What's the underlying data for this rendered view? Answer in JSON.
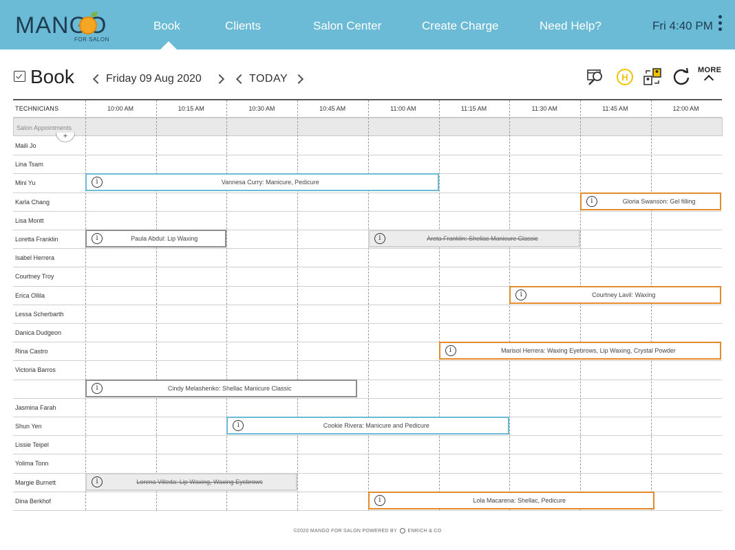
{
  "header": {
    "logo": {
      "word": "MANGO",
      "sub": "FOR SALON"
    },
    "nav": [
      "Book",
      "Clients",
      "Salon Center",
      "Create Charge",
      "Need Help?"
    ],
    "clock": "Fri 4:40 PM"
  },
  "toolbar": {
    "title": "Book",
    "date": "Friday 09 Aug 2020",
    "today": "TODAY",
    "more": "MORE",
    "icons": [
      "search-calendar-icon",
      "h-badge-icon",
      "swap-users-icon",
      "refresh-icon"
    ]
  },
  "grid": {
    "tech_header": "TECHNICIANS",
    "times": [
      "10:00 AM",
      "10:15 AM",
      "10:30 AM",
      "10:45 AM",
      "11:00 AM",
      "11:15 AM",
      "11:30 AM",
      "11:45 AM",
      "12:00 AM"
    ],
    "salon_row": "Salon Appointments",
    "salon_add": "+",
    "technicians": [
      "Maili Jo",
      "Lina Tsam",
      "Mini Yu",
      "Karla Chang",
      "Lisa Montt",
      "Loretta Franklin",
      "Isabel Herrera",
      "Courtney Troy",
      "Erica Ollila",
      "Lessa Scherbarth",
      "Danica Dudgeon",
      "Rina Castro",
      "Victoria Barros",
      "",
      "Jasmina Farah",
      "Shun Yen",
      "Lissie Teipel",
      "Yolima Tonn",
      "Margie Burnett",
      "Dina Berkhof"
    ]
  },
  "appointments": [
    {
      "row": 2,
      "start": "10:00 AM",
      "slots": 5,
      "status": "blue",
      "text": "Vannesa Curry: Manicure, Pedicure"
    },
    {
      "row": 3,
      "start": "11:45 AM",
      "slots": 2,
      "status": "orange",
      "text": "Gloria Swanson: Gel filling"
    },
    {
      "row": 5,
      "start": "10:00 AM",
      "slots": 2,
      "status": "gray",
      "text": "Paula Abdul: Lip Waxing"
    },
    {
      "row": 5,
      "start": "11:00 AM",
      "slots": 3,
      "status": "cancel",
      "text": "Areta Franklin: Shellac Manicure Classic"
    },
    {
      "row": 8,
      "start": "11:30 AM",
      "slots": 3,
      "status": "orange",
      "text": "Courtney Lavil: Waxing"
    },
    {
      "row": 11,
      "start": "11:15 AM",
      "slots": 4,
      "status": "orange",
      "text": "Marisol Herrera: Waxing Eyebrows, Lip Waxing, Crystal Powder"
    },
    {
      "row": 13,
      "start": "10:00 AM",
      "slots": 3.85,
      "status": "gray",
      "text": "Cindy Melashenko: Shellac Manicure Classic"
    },
    {
      "row": 15,
      "start": "10:30 AM",
      "slots": 4,
      "status": "blue",
      "text": "Cookie Rivera: Manicure and Pedicure"
    },
    {
      "row": 18,
      "start": "10:00 AM",
      "slots": 3,
      "status": "cancel",
      "text": "Lorena Villeda: Lip Waxing, Waxing Eyebrows"
    },
    {
      "row": 19,
      "start": "11:00 AM",
      "slots": 4.05,
      "status": "orange",
      "text": "Lola Macarena: Shellac, Pedicure"
    }
  ],
  "colors": {
    "topbar": "#6bbad6",
    "blue": "#6bbad6",
    "orange": "#e38a2a",
    "gray": "#8c8c8c",
    "cancel_bg": "#ececec"
  },
  "footer": {
    "text": "©2020 MANGO FOR SALON POWERED BY",
    "brand": "ENRICH & CO"
  }
}
